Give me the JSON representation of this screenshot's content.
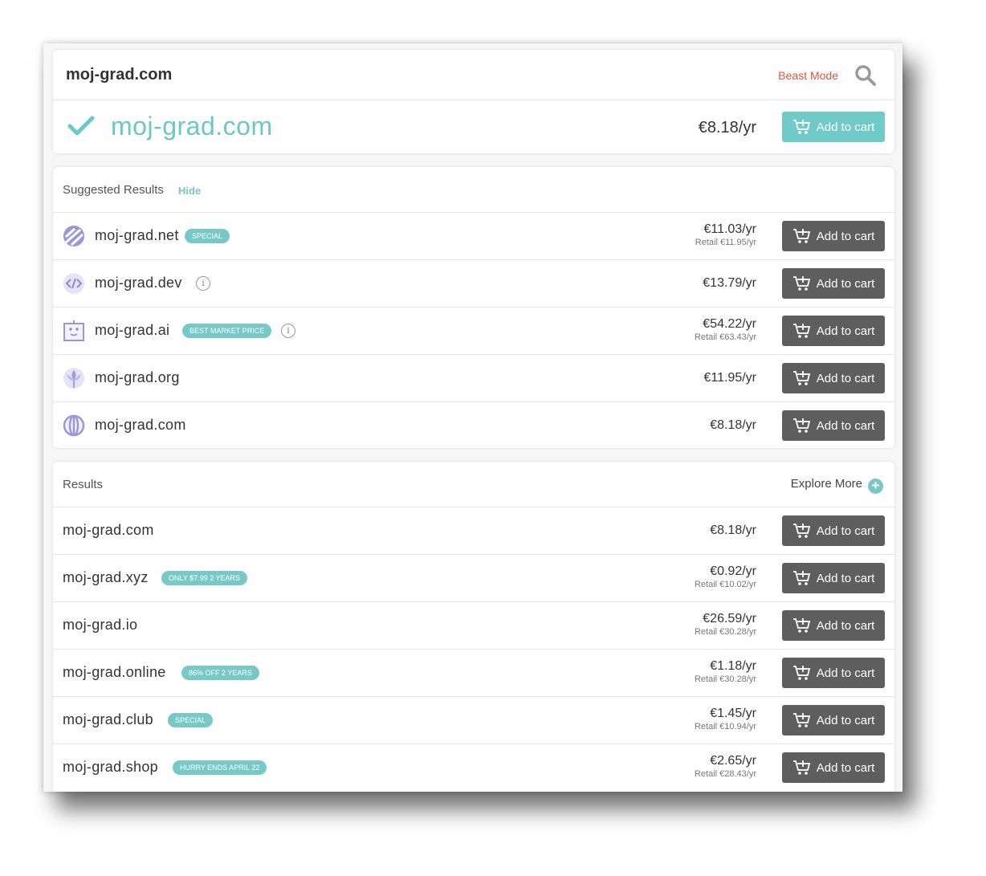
{
  "search": {
    "query": "moj-grad.com",
    "beast_mode": "Beast Mode",
    "exact": {
      "domain": "moj-grad.com",
      "price": "€8.18/yr",
      "button": "Add to cart"
    }
  },
  "suggested": {
    "title": "Suggested Results",
    "hide": "Hide",
    "items": [
      {
        "domain": "moj-grad.net",
        "icon": "net-icon",
        "badge": "SPECIAL",
        "price": "€11.03/yr",
        "retail": "Retail €11.95/yr",
        "button": "Add to cart"
      },
      {
        "domain": "moj-grad.dev",
        "icon": "code-icon",
        "badge": "",
        "info": "i",
        "price": "€13.79/yr",
        "retail": "",
        "button": "Add to cart"
      },
      {
        "domain": "moj-grad.ai",
        "icon": "robot-icon",
        "badge": "BEST MARKET PRICE",
        "info": "i",
        "price": "€54.22/yr",
        "retail": "Retail €63.43/yr",
        "button": "Add to cart"
      },
      {
        "domain": "moj-grad.org",
        "icon": "lotus-icon",
        "badge": "",
        "price": "€11.95/yr",
        "retail": "",
        "button": "Add to cart"
      },
      {
        "domain": "moj-grad.com",
        "icon": "globe-icon",
        "badge": "",
        "price": "€8.18/yr",
        "retail": "",
        "button": "Add to cart"
      }
    ]
  },
  "results": {
    "title": "Results",
    "explore": "Explore More",
    "items": [
      {
        "domain": "moj-grad.com",
        "badge": "",
        "price": "€8.18/yr",
        "retail": "",
        "button": "Add to cart"
      },
      {
        "domain": "moj-grad.xyz",
        "badge": "ONLY $7.99 2 YEARS",
        "price": "€0.92/yr",
        "retail": "Retail €10.02/yr",
        "button": "Add to cart"
      },
      {
        "domain": "moj-grad.io",
        "badge": "",
        "price": "€26.59/yr",
        "retail": "Retail €30.28/yr",
        "button": "Add to cart"
      },
      {
        "domain": "moj-grad.online",
        "badge": "86% OFF 2 YEARS",
        "price": "€1.18/yr",
        "retail": "Retail €30.28/yr",
        "button": "Add to cart"
      },
      {
        "domain": "moj-grad.club",
        "badge": "SPECIAL",
        "price": "€1.45/yr",
        "retail": "Retail €10.94/yr",
        "button": "Add to cart"
      },
      {
        "domain": "moj-grad.shop",
        "badge": "HURRY ENDS APRIL 22",
        "price": "€2.65/yr",
        "retail": "Retail €28.43/yr",
        "button": "Add to cart"
      }
    ]
  },
  "colors": {
    "accent": "#6fcac8",
    "beast": "#e05440",
    "button": "#5e5e5e",
    "icon": "#9b95d9"
  }
}
